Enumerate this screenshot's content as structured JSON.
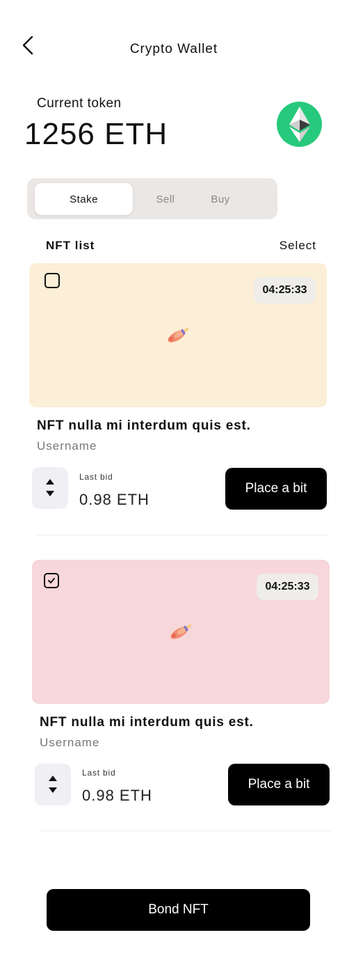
{
  "header": {
    "title": "Crypto Wallet"
  },
  "token": {
    "label": "Current token",
    "value": "1256 ETH",
    "badge_icon": "ethereum-icon",
    "badge_color": "#27c97c"
  },
  "tabs": [
    {
      "label": "Stake",
      "active": true
    },
    {
      "label": "Sell",
      "active": false
    },
    {
      "label": "Buy",
      "active": false
    }
  ],
  "nft_list": {
    "title": "NFT list",
    "select_label": "Select",
    "items": [
      {
        "checked": false,
        "timer": "04:25:33",
        "background": "#fcefd7",
        "name": "NFT nulla mi interdum quis est.",
        "username": "Username",
        "bid_label": "Last bid",
        "bid_value": "0.98 ETH",
        "button": "Place a bit"
      },
      {
        "checked": true,
        "timer": "04:25:33",
        "background": "#f7d7d9",
        "name": "NFT nulla mi interdum quis est.",
        "username": "Username",
        "bid_label": "Last bid",
        "bid_value": "0.98 ETH",
        "button": "Place a bit"
      }
    ]
  },
  "footer": {
    "bond_button": "Bond NFT"
  }
}
